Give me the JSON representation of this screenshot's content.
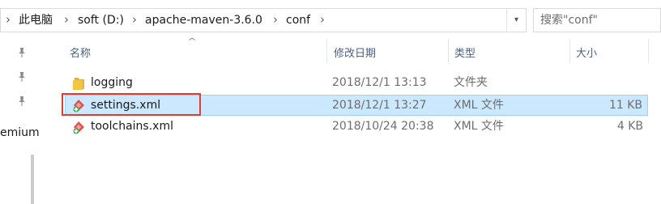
{
  "address_bar": {
    "breadcrumbs": [
      "此电脑",
      "soft (D:)",
      "apache-maven-3.6.0",
      "conf"
    ],
    "separator": "›"
  },
  "search": {
    "placeholder": "搜索\"conf\""
  },
  "nav_pane": {
    "partial_label": "emium"
  },
  "columns": {
    "name": "名称",
    "date": "修改日期",
    "type": "类型",
    "size": "大小"
  },
  "files": [
    {
      "name": "logging",
      "date": "2018/12/1 13:13",
      "type": "文件夹",
      "size": "",
      "icon": "folder-icon"
    },
    {
      "name": "settings.xml",
      "date": "2018/12/1 13:27",
      "type": "XML 文件",
      "size": "11 KB",
      "icon": "xml-file-icon",
      "selected": true,
      "highlighted": true
    },
    {
      "name": "toolchains.xml",
      "date": "2018/10/24 20:38",
      "type": "XML 文件",
      "size": "4 KB",
      "icon": "xml-file-icon"
    }
  ],
  "colors": {
    "selection_bg": "#cce8ff",
    "selection_border": "#99d1ff",
    "highlight_box": "#e03c31",
    "column_header_text": "#4d6082",
    "folder": "#f5c542"
  }
}
